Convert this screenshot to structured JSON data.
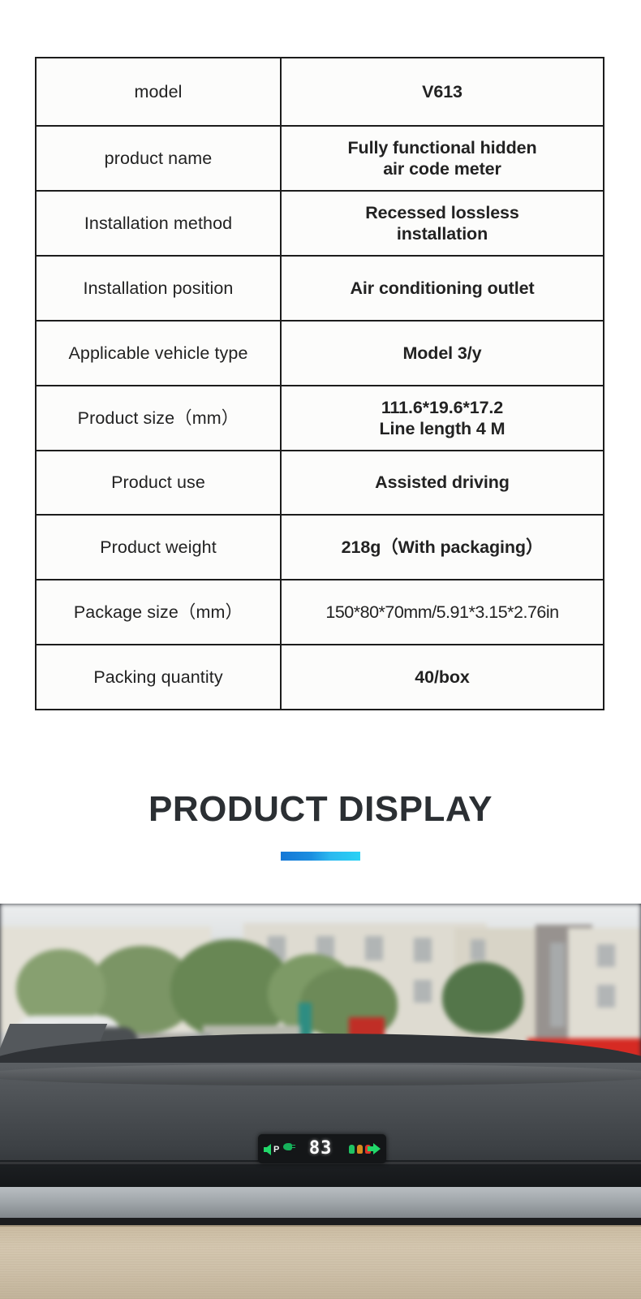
{
  "spec_table": {
    "rows": [
      {
        "label": "model",
        "value_lines": [
          "V613"
        ],
        "bold": true
      },
      {
        "label": "product name",
        "value_lines": [
          "Fully functional hidden",
          "air code meter"
        ],
        "bold": true
      },
      {
        "label": "Installation method",
        "value_lines": [
          "Recessed lossless",
          "installation"
        ],
        "bold": true
      },
      {
        "label": "Installation position",
        "value_lines": [
          "Air conditioning outlet"
        ],
        "bold": true
      },
      {
        "label": "Applicable vehicle type",
        "value_lines": [
          "Model 3/y"
        ],
        "bold": true
      },
      {
        "label": "Product size（mm）",
        "value_lines": [
          "111.6*19.6*17.2",
          "Line length 4 M"
        ],
        "bold": true
      },
      {
        "label": "Product use",
        "value_lines": [
          "Assisted driving"
        ],
        "bold": true
      },
      {
        "label": "Product weight",
        "value_lines": [
          "218g（With packaging）"
        ],
        "bold": true
      },
      {
        "label": "Package size（mm）",
        "value_lines": [
          "150*80*70mm/5.91*3.15*2.76in"
        ],
        "bold": false
      },
      {
        "label": "Packing quantity",
        "value_lines": [
          "40/box"
        ],
        "bold": true
      }
    ]
  },
  "section": {
    "title": "PRODUCT DISPLAY",
    "accent_gradient_from": "#1477d6",
    "accent_gradient_to": "#2ad2f5"
  },
  "photo": {
    "alt": "car-dashboard-hud-installed",
    "hud": {
      "left_turn_arrow": "left-turn-arrow",
      "gear_indicator": "P",
      "headlight_indicator": "headlight-icon",
      "speed_value": "83",
      "right_turn_arrow": "right-turn-arrow",
      "telltales": [
        {
          "name": "seatbelt-indicator",
          "color": "#1fc463"
        },
        {
          "name": "door-ajar-indicator",
          "color": "#d98a1e"
        },
        {
          "name": "warning-indicator",
          "color": "#e0342a"
        }
      ]
    }
  }
}
